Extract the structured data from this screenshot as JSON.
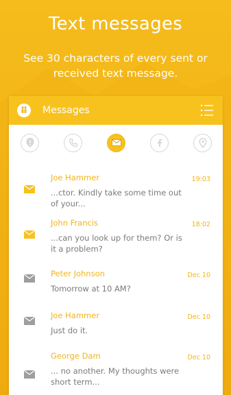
{
  "promo": {
    "title": "Text messages",
    "subtitle": "See 30 characters of every sent or received text message."
  },
  "header": {
    "title": "Messages",
    "logo_icon": "child-logo-icon",
    "menu_icon": "menu-icon"
  },
  "tabs": [
    {
      "name": "alert-icon",
      "active": false
    },
    {
      "name": "phone-icon",
      "active": false
    },
    {
      "name": "envelope-icon",
      "active": true
    },
    {
      "name": "facebook-icon",
      "active": false
    },
    {
      "name": "location-pin-icon",
      "active": false
    }
  ],
  "messages": [
    {
      "name": "Joe Hammer",
      "time": "19:03",
      "text": "...ctor. Kindly take some time out of your...",
      "unread": true
    },
    {
      "name": "John Francis",
      "time": "18:02",
      "text": "...can you look up for them? Or is it a problem?",
      "unread": true
    },
    {
      "name": "Peter Johnson",
      "time": "Dec 10",
      "text": "Tomorrow at 10 AM?",
      "unread": false
    },
    {
      "name": "Joe Hammer",
      "time": "Dec 10",
      "text": "Just do  it.",
      "unread": false
    },
    {
      "name": "George Dam",
      "time": "Dec 10",
      "text": "... no another. My thoughts were short term...",
      "unread": false
    }
  ],
  "colors": {
    "accent": "#F8C21E",
    "accent_text": "#F2B418",
    "unread_icon": "#F8C21E",
    "read_icon": "#9E9E9E",
    "body_text": "#7A7A7A"
  }
}
